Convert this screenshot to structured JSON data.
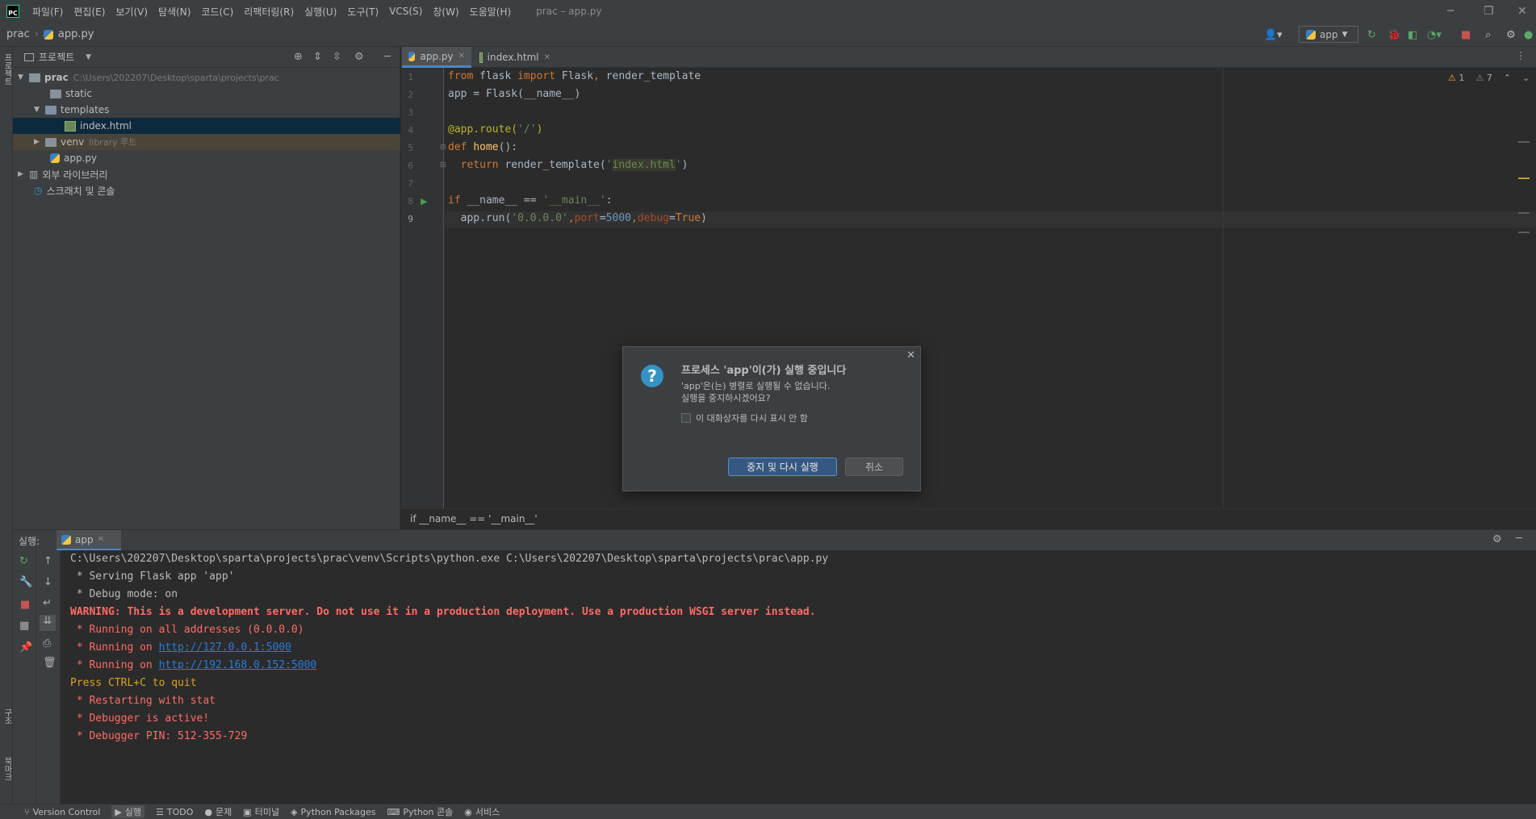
{
  "app": {
    "window_title": "prac – app.py",
    "menu": [
      "파일(F)",
      "편집(E)",
      "보기(V)",
      "탐색(N)",
      "코드(C)",
      "리팩터링(R)",
      "실행(U)",
      "도구(T)",
      "VCS(S)",
      "창(W)",
      "도움말(H)"
    ]
  },
  "navbar": {
    "breadcrumb_project": "prac",
    "breadcrumb_file": "app.py",
    "run_config": "app"
  },
  "left_strip": {
    "project_label": "프로젝트",
    "structure_label": "구조",
    "bookmarks_label": "북마크"
  },
  "project_panel": {
    "title": "프로젝트",
    "tree": {
      "root": "prac",
      "root_path": "C:\\Users\\202207\\Desktop\\sparta\\projects\\prac",
      "static": "static",
      "templates": "templates",
      "index": "index.html",
      "venv": "venv",
      "venv_hint": "library 루트",
      "app": "app.py",
      "external": "외부 라이브러리",
      "scratch": "스크래치 및 콘솔"
    }
  },
  "editor": {
    "tabs": [
      "app.py",
      "index.html"
    ],
    "line_numbers": [
      "1",
      "2",
      "3",
      "4",
      "5",
      "6",
      "7",
      "8",
      "9"
    ],
    "inspection": {
      "warnings": "1",
      "weak_warnings": "7"
    },
    "breadcrumb": "if __name__ == '__main__'"
  },
  "run_panel": {
    "label": "실행:",
    "tab": "app",
    "lines": {
      "l1": "C:\\Users\\202207\\Desktop\\sparta\\projects\\prac\\venv\\Scripts\\python.exe C:\\Users\\202207\\Desktop\\sparta\\projects\\prac\\app.py",
      "l2": " * Serving Flask app 'app'",
      "l3": " * Debug mode: on",
      "l4": "WARNING: This is a development server. Do not use it in a production deployment. Use a production WSGI server instead.",
      "l5": " * Running on all addresses (0.0.0.0)",
      "l6_prefix": " * Running on ",
      "l6_link": "http://127.0.0.1:5000",
      "l7_prefix": " * Running on ",
      "l7_link": "http://192.168.0.152:5000",
      "l8": "Press CTRL+C to quit",
      "l9": " * Restarting with stat",
      "l10": " * Debugger is active!",
      "l11": " * Debugger PIN: 512-355-729"
    }
  },
  "statusbar": {
    "items": [
      "Version Control",
      "실행",
      "TODO",
      "문제",
      "터미널",
      "Python Packages",
      "Python 콘솔",
      "서비스"
    ]
  },
  "dialog": {
    "title": "프로세스 'app'이(가) 실행 중입니다",
    "message1": "'app'은(는) 병렬로 실행될 수 없습니다.",
    "message2": "실행을 중지하시겠어요?",
    "checkbox_label": "이 대화상자를 다시 표시 안 함",
    "primary_button": "중지 및 다시 실행",
    "cancel_button": "취소"
  }
}
